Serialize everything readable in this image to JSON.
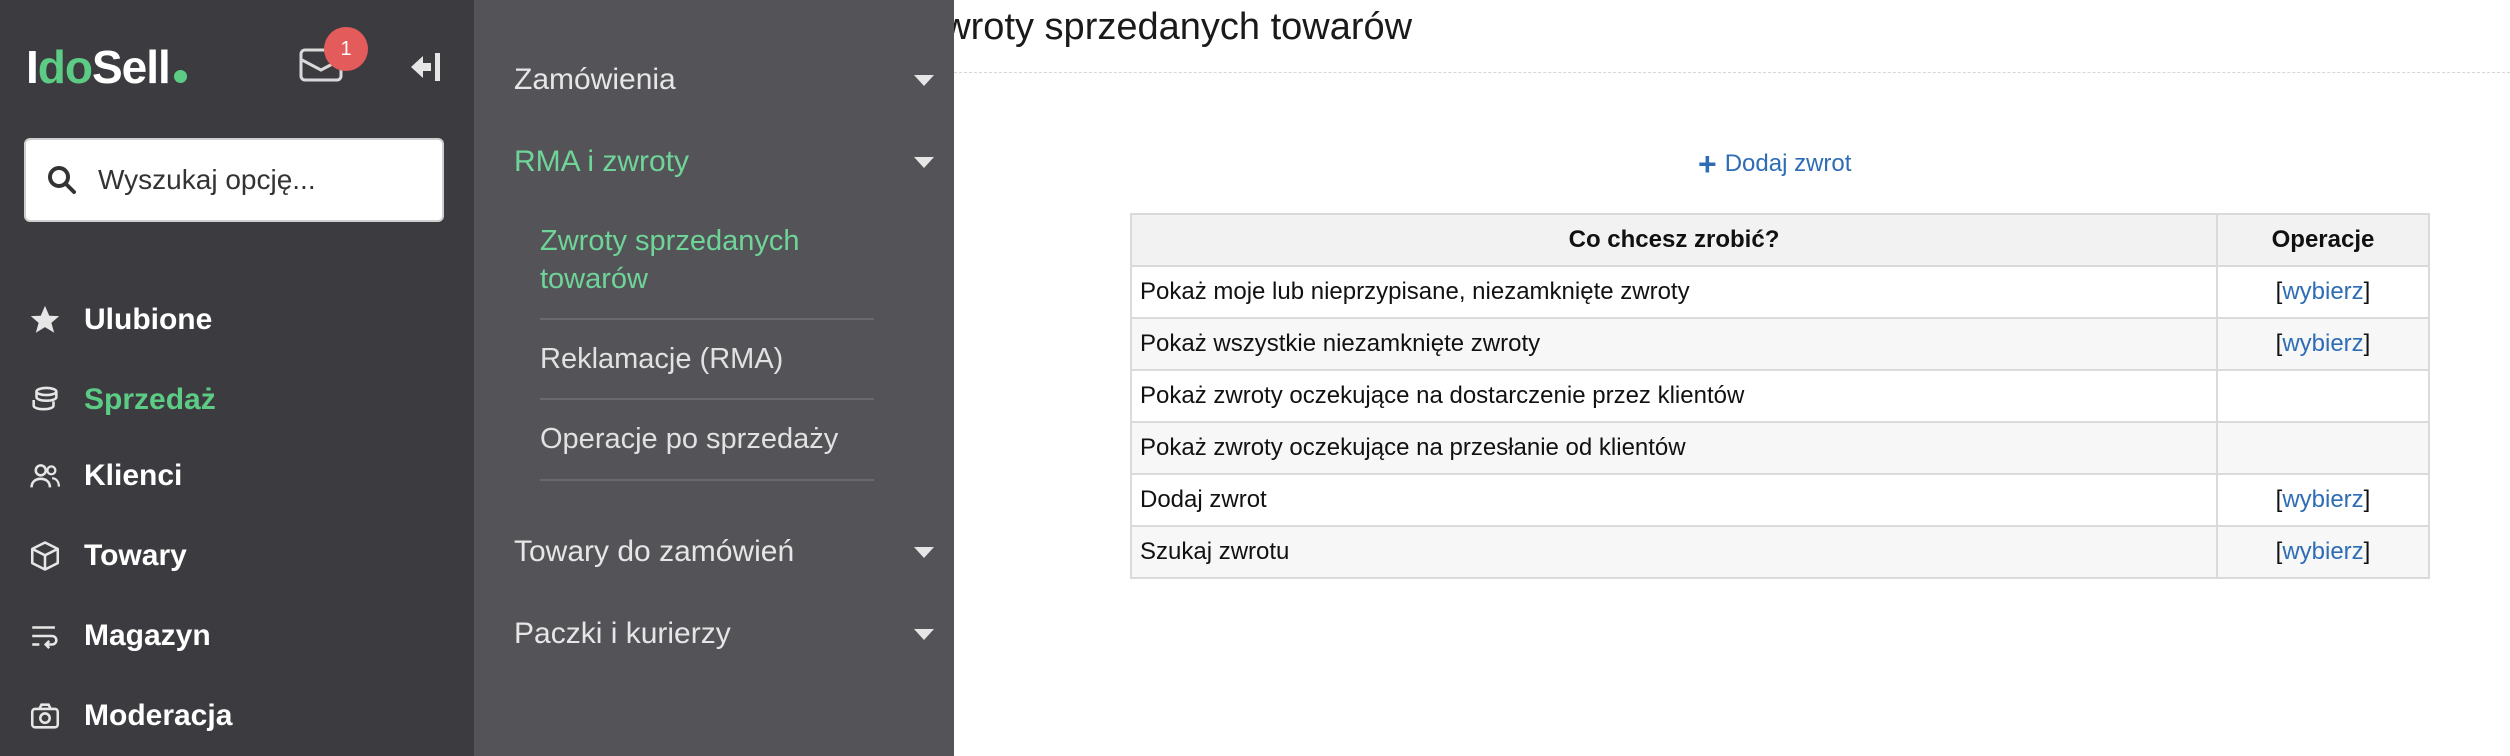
{
  "sidebar": {
    "logo": {
      "part1": "I",
      "part2": "do",
      "part3": "Sell"
    },
    "mail_badge": "1",
    "search": {
      "placeholder": "Wyszukaj opcję..."
    },
    "nav": [
      {
        "label": "Ulubione",
        "icon": "star-icon"
      },
      {
        "label": "Sprzedaż",
        "icon": "coins-icon",
        "active": true
      },
      {
        "label": "Klienci",
        "icon": "users-icon"
      },
      {
        "label": "Towary",
        "icon": "box-icon"
      },
      {
        "label": "Magazyn",
        "icon": "warehouse-icon"
      },
      {
        "label": "Moderacja",
        "icon": "camera-icon"
      }
    ]
  },
  "submenu": {
    "items": [
      {
        "label": "Zamówienia"
      },
      {
        "label": "RMA i zwroty",
        "active": true
      },
      {
        "label": "Towary do zamówień"
      },
      {
        "label": "Paczki i kurierzy"
      }
    ],
    "children": [
      {
        "label": "Zwroty sprzedanych towarów",
        "active": true
      },
      {
        "label": "Reklamacje (RMA)"
      },
      {
        "label": "Operacje po sprzedaży"
      }
    ]
  },
  "main": {
    "title": "Zwroty sprzedanych towarów",
    "add_return_label": "Dodaj zwrot",
    "table": {
      "headers": [
        "Co chcesz zrobić?",
        "Operacje"
      ],
      "rows": [
        {
          "what": "Pokaż moje lub nieprzypisane, niezamknięte zwroty",
          "op": "wybierz"
        },
        {
          "what": "Pokaż wszystkie niezamknięte zwroty",
          "op": "wybierz"
        },
        {
          "what": "Pokaż zwroty oczekujące na dostarczenie przez klientów",
          "op": ""
        },
        {
          "what": "Pokaż zwroty oczekujące na przesłanie od klientów",
          "op": ""
        },
        {
          "what": "Dodaj zwrot",
          "op": "wybierz"
        },
        {
          "what": "Szukaj zwrotu",
          "op": "wybierz"
        }
      ]
    }
  },
  "colors": {
    "sidebar_bg": "#3c3c40",
    "submenu_bg": "#545458",
    "accent": "#5ccc85",
    "link": "#2e6db5",
    "badge": "#e35b5b"
  }
}
